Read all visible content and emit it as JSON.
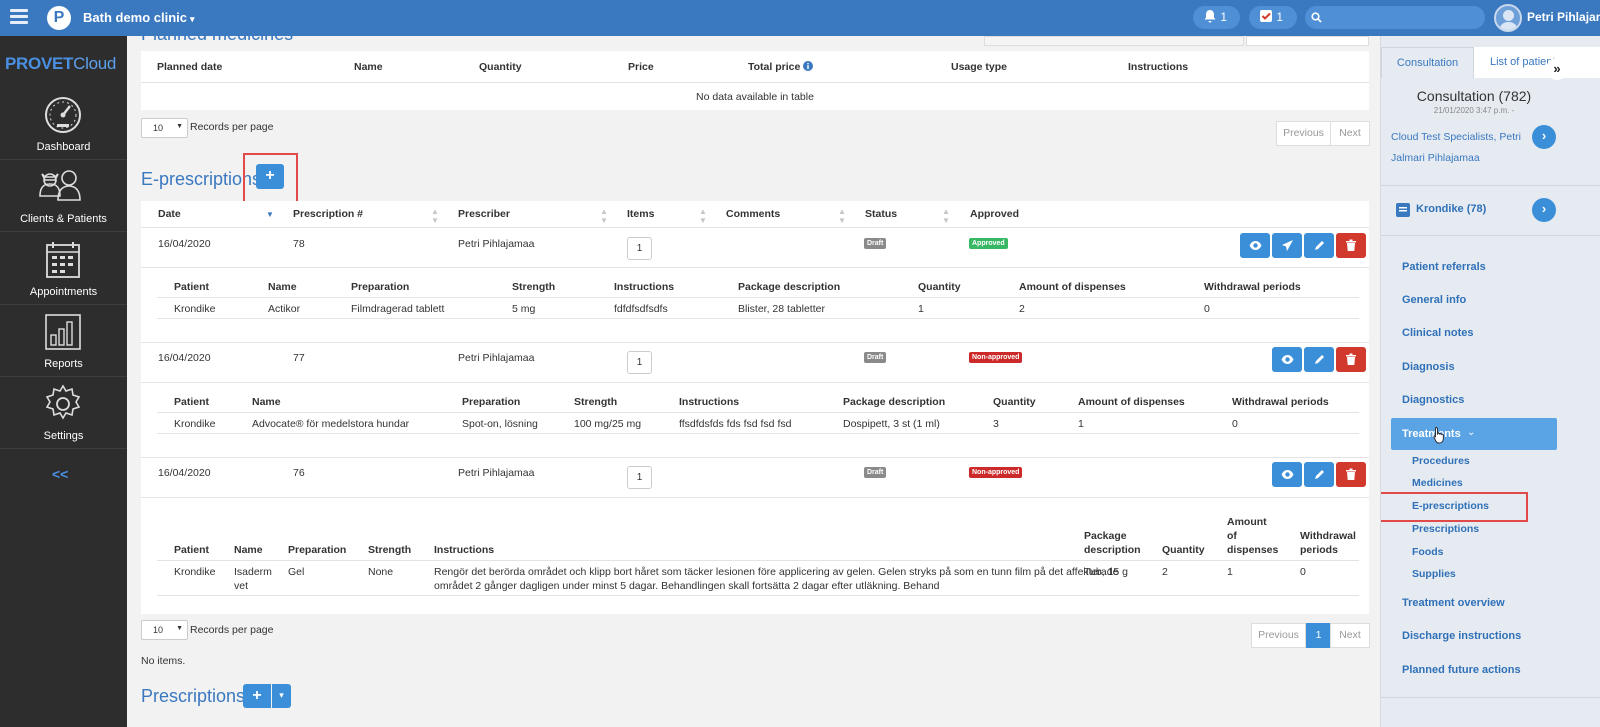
{
  "topbar": {
    "clinic": "Bath demo clinic",
    "notifications_count": "1",
    "tasks_count": "1",
    "user_name": "Petri Pihlajamaa"
  },
  "sidebar": {
    "brand": "PROVET",
    "brand_suffix": "Cloud",
    "items": [
      {
        "label": "Dashboard",
        "icon": "dashboard-icon"
      },
      {
        "label": "Clients & Patients",
        "icon": "clients-patients-icon"
      },
      {
        "label": "Appointments",
        "icon": "calendar-icon"
      },
      {
        "label": "Reports",
        "icon": "bar-chart-icon"
      },
      {
        "label": "Settings",
        "icon": "gear-icon"
      }
    ],
    "collapse": "<<"
  },
  "planned_medicines": {
    "title": "Planned medicines",
    "columns": [
      "Planned date",
      "Name",
      "Quantity",
      "Price",
      "Total price",
      "Usage type",
      "Instructions"
    ],
    "empty": "No data available in table",
    "records_per_page": "10",
    "records_label": "Records per page",
    "prev": "Previous",
    "next": "Next"
  },
  "eprescriptions": {
    "title": "E-prescriptions",
    "add": "+",
    "columns": [
      "Date",
      "Prescription #",
      "Prescriber",
      "Items",
      "Comments",
      "Status",
      "Approved"
    ],
    "rows": [
      {
        "date": "16/04/2020",
        "number": "78",
        "prescriber": "Petri Pihlajamaa",
        "items": "1",
        "status": "Draft",
        "approved": "Approved",
        "approved_color": "#38b865",
        "detail_columns": [
          "Patient",
          "Name",
          "Preparation",
          "Strength",
          "Instructions",
          "Package description",
          "Quantity",
          "Amount of dispenses",
          "Withdrawal periods"
        ],
        "detail": [
          "Krondike",
          "Actikor",
          "Filmdragerad tablett",
          "5 mg",
          "fdfdfsdfsdfs",
          "Blister, 28 tabletter",
          "1",
          "2",
          "0"
        ]
      },
      {
        "date": "16/04/2020",
        "number": "77",
        "prescriber": "Petri Pihlajamaa",
        "items": "1",
        "status": "Draft",
        "approved": "Non-approved",
        "approved_color": "#cc2a2a",
        "detail_columns": [
          "Patient",
          "Name",
          "Preparation",
          "Strength",
          "Instructions",
          "Package description",
          "Quantity",
          "Amount of dispenses",
          "Withdrawal periods"
        ],
        "detail": [
          "Krondike",
          "Advocate® för medelstora hundar",
          "Spot-on, lösning",
          "100 mg/25 mg",
          "ffsdfdsfds fds fsd fsd fsd",
          "Dospipett, 3 st (1 ml)",
          "3",
          "1",
          "0"
        ]
      },
      {
        "date": "16/04/2020",
        "number": "76",
        "prescriber": "Petri Pihlajamaa",
        "items": "1",
        "status": "Draft",
        "approved": "Non-approved",
        "approved_color": "#cc2a2a",
        "detail_columns": [
          "Patient",
          "Name",
          "Preparation",
          "Strength",
          "Instructions",
          "Package",
          "description",
          "Quantity",
          "Amount",
          "of",
          "dispenses",
          "Withdrawal",
          "periods"
        ],
        "detail": [
          "Krondike",
          "Isaderm",
          "vet",
          "Gel",
          "None",
          "Rengör det berörda området och klipp bort håret som täcker lesionen före applicering av gelen. Gelen stryks på som en tunn film på det affekterade",
          "området 2 gånger dagligen under minst 5 dagar. Behandlingen skall fortsätta 2 dagar efter utläkning. Behand",
          "Tub, 15 g",
          "2",
          "1",
          "0"
        ]
      }
    ],
    "records_per_page": "10",
    "records_label": "Records per page",
    "prev": "Previous",
    "page": "1",
    "next": "Next",
    "no_items": "No items."
  },
  "prescriptions": {
    "title": "Prescriptions",
    "add": "+",
    "caret": "▾"
  },
  "right_panel": {
    "tabs": [
      "Consultation",
      "List of patients"
    ],
    "title": "Consultation (782)",
    "date": "21/01/2020 3:47 p.m. -",
    "vet_line1": "Cloud Test Specialists, Petri",
    "vet_line2": "Jalmari Pihlajamaa",
    "patient": "Krondike (78)",
    "menu": [
      "Patient referrals",
      "General info",
      "Clinical notes",
      "Diagnosis",
      "Diagnostics",
      "Treatments"
    ],
    "submenu": [
      "Procedures",
      "Medicines",
      "E-prescriptions",
      "Prescriptions",
      "Foods",
      "Supplies"
    ],
    "menu2": [
      "Treatment overview",
      "Discharge instructions",
      "Planned future actions"
    ],
    "expand": "»"
  }
}
